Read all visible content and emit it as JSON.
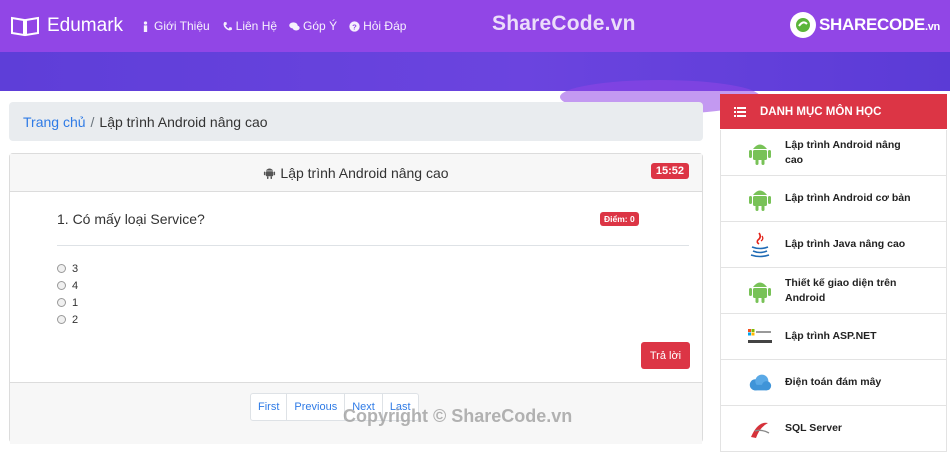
{
  "header": {
    "brand": "Edumark",
    "nav": [
      {
        "label": "Giới Thiệu",
        "icon": "info-icon"
      },
      {
        "label": "Liên Hệ",
        "icon": "phone-icon"
      },
      {
        "label": "Góp Ý",
        "icon": "comments-icon"
      },
      {
        "label": "Hỏi Đáp",
        "icon": "question-circle-icon"
      }
    ],
    "watermark": "ShareCode.vn",
    "logo_main": "SHARECODE",
    "logo_suffix": ".vn"
  },
  "breadcrumb": {
    "home": "Trang chủ",
    "separator": "/",
    "current": "Lập trình Android nâng cao"
  },
  "quiz": {
    "title": "Lập trình Android nâng cao",
    "timer": "15:52",
    "question": "1. Có mấy loại Service?",
    "score": "Điểm: 0",
    "options": [
      "3",
      "4",
      "1",
      "2"
    ],
    "submit_label": "Trả lời",
    "pagination": [
      "First",
      "Previous",
      "Next",
      "Last"
    ]
  },
  "footer_watermark": "Copyright © ShareCode.vn",
  "sidebar": {
    "title": "DANH MỤC MÔN HỌC",
    "items": [
      {
        "label": "Lập trình Android nâng cao",
        "icon": "android-icon"
      },
      {
        "label": "Lập trình Android cơ bản",
        "icon": "android-icon"
      },
      {
        "label": "Lập trình Java nâng cao",
        "icon": "java-icon"
      },
      {
        "label": "Thiết kế giao diện trên Android",
        "icon": "android-icon"
      },
      {
        "label": "Lập trình ASP.NET",
        "icon": "aspnet-icon"
      },
      {
        "label": "Điện toán đám mây",
        "icon": "cloud-icon"
      },
      {
        "label": "SQL Server",
        "icon": "sql-server-icon"
      }
    ]
  },
  "colors": {
    "header_purple": "#9146e6",
    "band_indigo": "#5e3ed8",
    "accent_red": "#dc3545",
    "link_blue": "#2f7be6",
    "android_green": "#78c257"
  }
}
